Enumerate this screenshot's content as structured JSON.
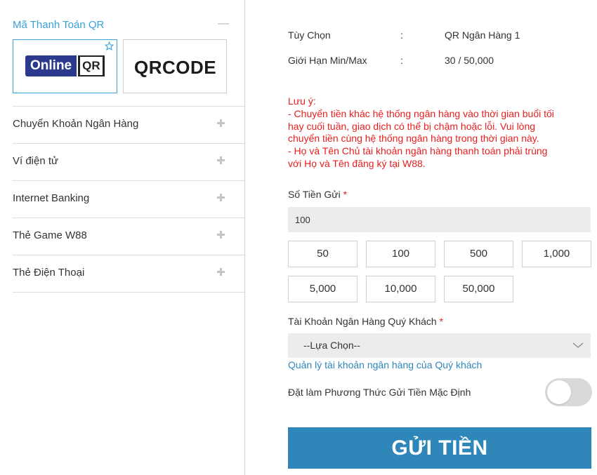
{
  "payment_menu": {
    "qr_section": {
      "title": "Mã Thanh Toán QR",
      "options": [
        {
          "logo_word": "Online",
          "logo_qr": "QR",
          "icon": "star-icon",
          "selected": true
        },
        {
          "logo_text": "QRCODE",
          "selected": false
        }
      ]
    },
    "items": [
      {
        "label": "Chuyển Khoản Ngân Hàng",
        "icon": "plus-icon"
      },
      {
        "label": "Ví điện tử",
        "icon": "plus-icon"
      },
      {
        "label": "Internet Banking",
        "icon": "plus-icon"
      },
      {
        "label": "Thẻ Game W88",
        "icon": "plus-icon"
      },
      {
        "label": "Thẻ Điện Thoại",
        "icon": "plus-icon"
      }
    ]
  },
  "details": {
    "option": {
      "label": "Tùy Chọn",
      "separator": ":",
      "value": "QR Ngân Hàng 1"
    },
    "limits": {
      "label": "Giới Hạn Min/Max",
      "separator": ":",
      "value": "30 / 50,000"
    }
  },
  "note": {
    "lines": [
      "Lưu ý:",
      "- Chuyển tiền khác hệ thống ngân hàng vào thời gian buổi tối",
      "hay cuối tuần, giao dịch có thể bị chậm hoặc lỗi. Vui lòng",
      "chuyển tiền cùng hệ thống ngân hàng trong thời gian này.",
      "- Họ và Tên Chủ tài khoản ngân hàng thanh toán phải trùng",
      "với Họ và Tên đăng ký tại W88."
    ]
  },
  "amount": {
    "label": "Số Tiền Gửi",
    "required_mark": "*",
    "value": "100",
    "quick_amounts": [
      "50",
      "100",
      "500",
      "1,000",
      "5,000",
      "10,000",
      "50,000"
    ]
  },
  "bank_account": {
    "label": "Tài Khoản Ngân Hàng Quý Khách",
    "required_mark": "*",
    "selected": "--Lựa Chọn--",
    "manage_link": "Quản lý tài khoản ngân hàng của Quý khách"
  },
  "default_method": {
    "label": "Đặt làm Phương Thức Gửi Tiền Mặc Định",
    "enabled": false
  },
  "submit": {
    "label": "GỬI TIỀN"
  },
  "colors": {
    "accent": "#2f86b9",
    "link": "#3aa0d8",
    "warning": "#e81e1e",
    "input_bg": "#ececec"
  }
}
